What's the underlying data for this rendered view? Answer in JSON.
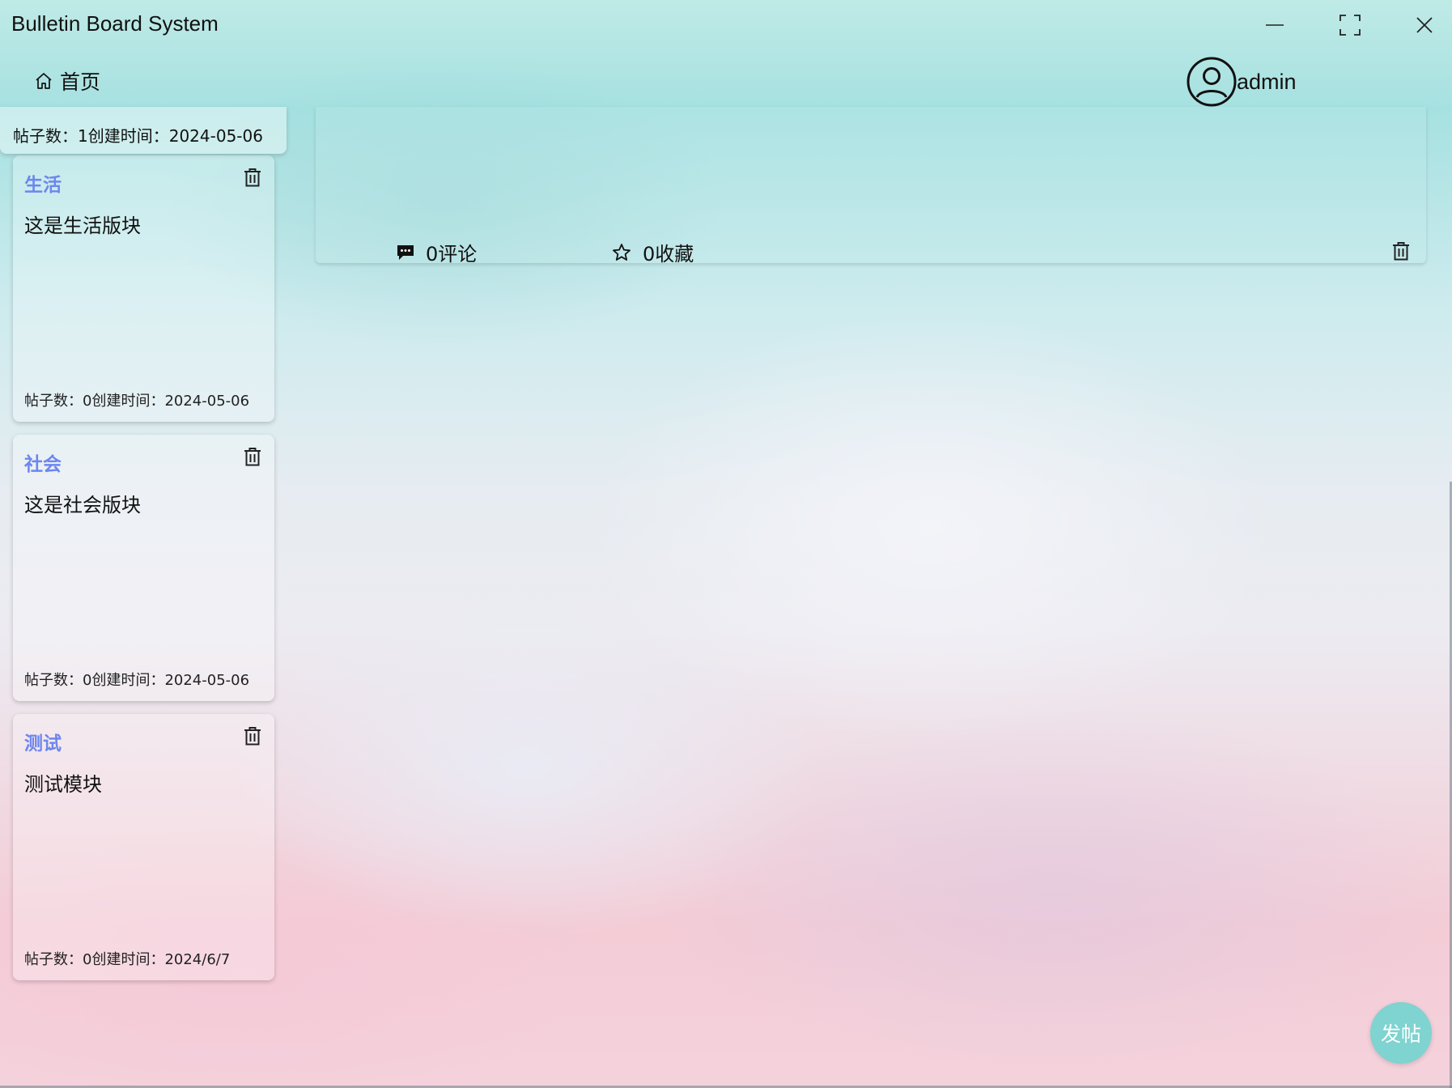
{
  "window": {
    "title": "Bulletin Board System",
    "controls": [
      "minimize-icon",
      "maximize-icon",
      "close-icon"
    ]
  },
  "nav": {
    "home_label": "首页",
    "home_icon": "home-icon",
    "user_icon": "user-avatar-icon",
    "username": "admin"
  },
  "boards": {
    "partial_top": {
      "meta": "帖子数：1创建时间：2024-05-06"
    },
    "items": [
      {
        "name": "生活",
        "description": "这是生活版块",
        "meta": "帖子数：0创建时间：2024-05-06"
      },
      {
        "name": "社会",
        "description": "这是社会版块",
        "meta": "帖子数：0创建时间：2024-05-06"
      },
      {
        "name": "测试",
        "description": "测试模块",
        "meta": "帖子数：0创建时间：2024/6/7"
      }
    ]
  },
  "post": {
    "comments_label": "0评论",
    "favorites_label": "0收藏"
  },
  "fab": {
    "label": "发帖"
  },
  "colors": {
    "board_title": "#6d86ee",
    "fab": "#7fd3d0"
  }
}
